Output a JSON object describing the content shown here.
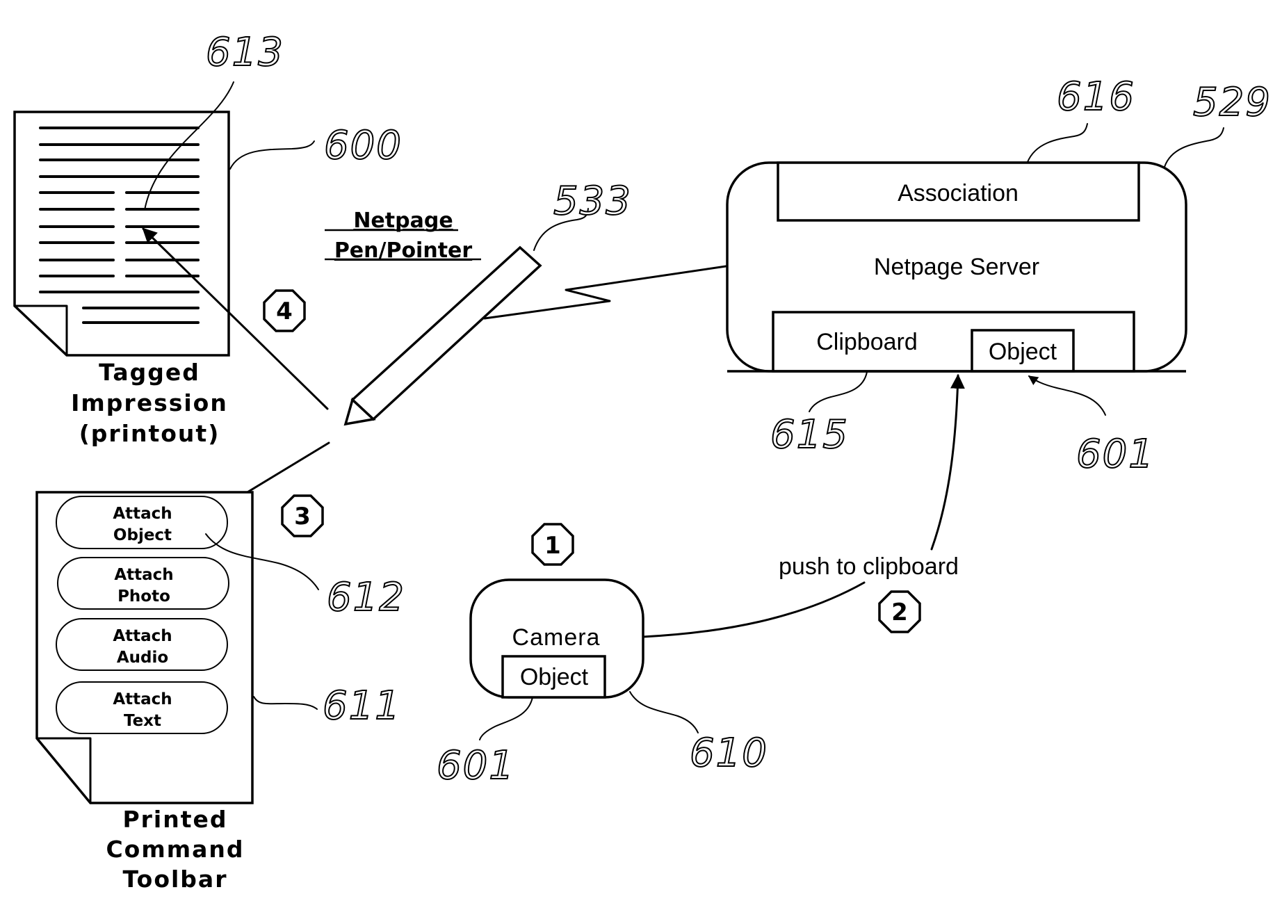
{
  "figure": {
    "tagged_impression": {
      "label_lines": [
        "Tagged",
        "Impression",
        "(printout)"
      ],
      "ref": "600",
      "target_ref": "613"
    },
    "pen": {
      "label_lines": [
        "Netpage",
        "Pen/Pointer"
      ],
      "ref": "533"
    },
    "server": {
      "title": "Netpage Server",
      "ref": "529",
      "association": {
        "label": "Association",
        "ref": "616"
      },
      "clipboard": {
        "label": "Clipboard",
        "ref": "615"
      },
      "object": {
        "label": "Object",
        "ref": "601"
      }
    },
    "camera": {
      "title": "Camera",
      "ref": "610",
      "object": {
        "label": "Object",
        "ref": "601"
      }
    },
    "toolbar": {
      "label_lines": [
        "Printed",
        "Command",
        "Toolbar"
      ],
      "ref": "611",
      "buttons": [
        {
          "line1": "Attach",
          "line2": "Object",
          "ref": "612"
        },
        {
          "line1": "Attach",
          "line2": "Photo"
        },
        {
          "line1": "Attach",
          "line2": "Audio"
        },
        {
          "line1": "Attach",
          "line2": "Text"
        }
      ]
    },
    "flow": {
      "push_label": "push to clipboard",
      "steps": [
        "1",
        "2",
        "3",
        "4"
      ]
    }
  }
}
